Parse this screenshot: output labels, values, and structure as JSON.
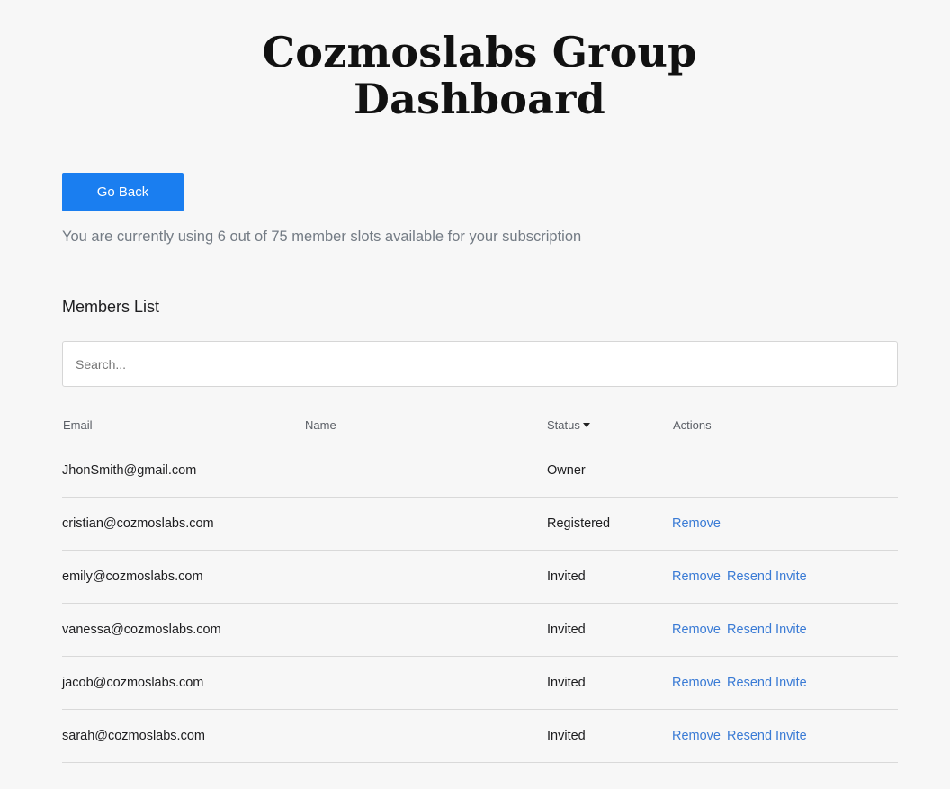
{
  "page_title": {
    "line1": "Cozmoslabs Group",
    "line2": "Dashboard"
  },
  "go_back_label": "Go Back",
  "usage_text": "You are currently using 6 out of 75 member slots available for your subscription",
  "members_list_title": "Members List",
  "search": {
    "placeholder": "Search...",
    "value": ""
  },
  "table": {
    "headers": {
      "email": "Email",
      "name": "Name",
      "status": "Status",
      "actions": "Actions"
    },
    "status_sort": "caret-down-icon",
    "rows": [
      {
        "email": "JhonSmith@gmail.com",
        "name": "",
        "status": "Owner",
        "remove": "",
        "resend": ""
      },
      {
        "email": "cristian@cozmoslabs.com",
        "name": "",
        "status": "Registered",
        "remove": "Remove",
        "resend": ""
      },
      {
        "email": "emily@cozmoslabs.com",
        "name": "",
        "status": "Invited",
        "remove": "Remove",
        "resend": "Resend Invite"
      },
      {
        "email": "vanessa@cozmoslabs.com",
        "name": "",
        "status": "Invited",
        "remove": "Remove",
        "resend": "Resend Invite"
      },
      {
        "email": "jacob@cozmoslabs.com",
        "name": "",
        "status": "Invited",
        "remove": "Remove",
        "resend": "Resend Invite"
      },
      {
        "email": "sarah@cozmoslabs.com",
        "name": "",
        "status": "Invited",
        "remove": "Remove",
        "resend": "Resend Invite"
      }
    ]
  },
  "colors": {
    "background": "#f7f7f7",
    "primary_button": "#1a7ef0",
    "link": "#3a7bd5",
    "muted_text": "#737b84"
  }
}
